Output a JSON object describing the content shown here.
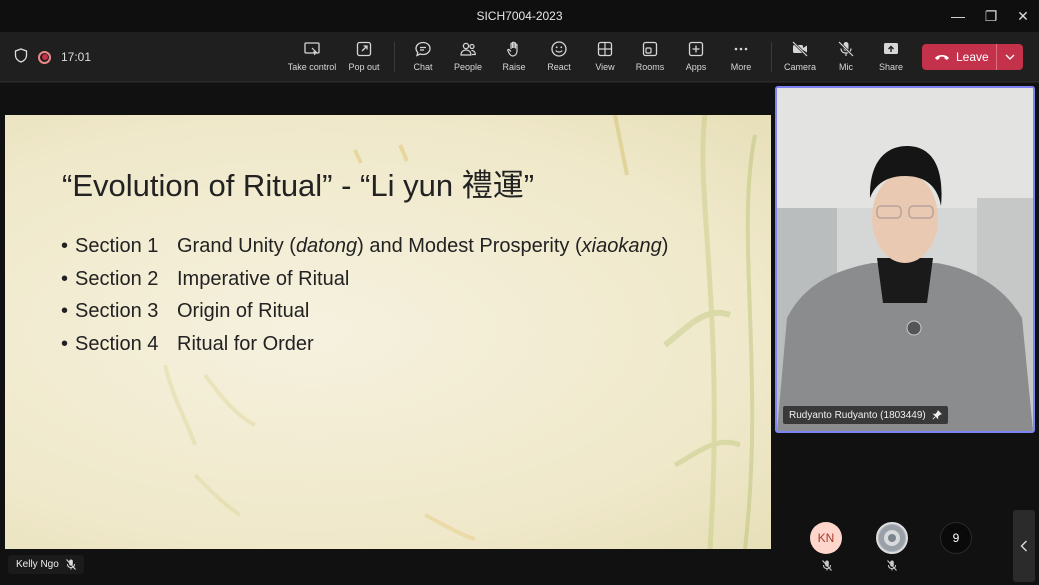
{
  "window": {
    "title": "SICH7004-2023",
    "minimize_glyph": "—",
    "restore_glyph": "❐",
    "close_glyph": "✕"
  },
  "toolbar": {
    "timer": "17:01",
    "buttons": {
      "take_control": "Take control",
      "pop_out": "Pop out",
      "chat": "Chat",
      "people": "People",
      "raise": "Raise",
      "react": "React",
      "view": "View",
      "rooms": "Rooms",
      "apps": "Apps",
      "more": "More",
      "camera": "Camera",
      "mic": "Mic",
      "share": "Share"
    },
    "leave_label": "Leave",
    "leave_color": "#c4314b"
  },
  "slide": {
    "title": "“Evolution of Ritual” - “Li yun 禮運”",
    "bullet": "•",
    "items": [
      {
        "section": "Section 1",
        "pre": "Grand Unity (",
        "em1": "datong",
        "mid": ") and Modest Prosperity (",
        "em2": "xiaokang",
        "post": ")"
      },
      {
        "section": "Section 2",
        "text": "Imperative of Ritual"
      },
      {
        "section": "Section 3",
        "text": "Origin of Ritual"
      },
      {
        "section": "Section 4",
        "text": "Ritual for Order"
      }
    ]
  },
  "presenter": {
    "name": "Kelly Ngo"
  },
  "video": {
    "name": "Rudyanto Rudyanto (1803449)",
    "border_color": "#7f85f5"
  },
  "participants": {
    "kn_initials": "KN",
    "overflow_count": "9"
  }
}
